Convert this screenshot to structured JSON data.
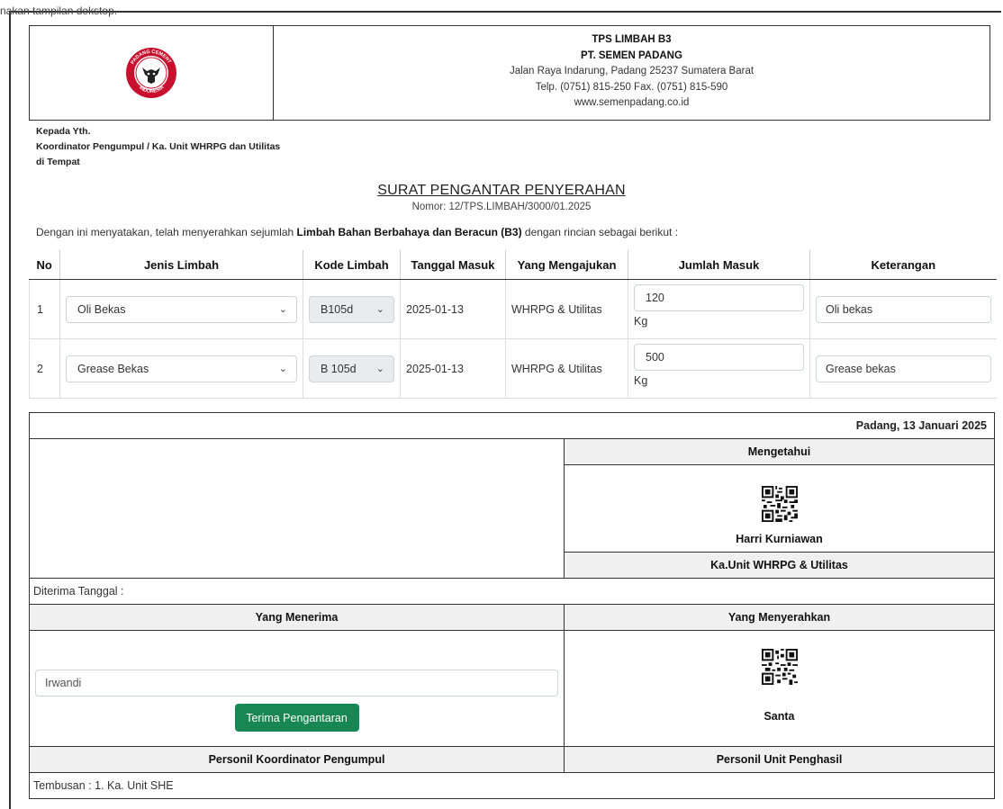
{
  "top_note": "nakan tampilan dekstop.",
  "header": {
    "logo_text": "PADANG CEMENT INDONESIA",
    "line1": "TPS LIMBAH B3",
    "line2": "PT. SEMEN PADANG",
    "line3": "Jalan Raya Indarung, Padang 25237 Sumatera Barat",
    "line4": "Telp. (0751) 815-250 Fax. (0751) 815-590",
    "line5": "www.semenpadang.co.id"
  },
  "address": {
    "line1": "Kepada Yth.",
    "line2": "Koordinator Pengumpul / Ka. Unit WHRPG dan Utilitas",
    "line3": "di Tempat"
  },
  "title": "SURAT PENGANTAR PENYERAHAN",
  "nomor": "Nomor: 12/TPS.LIMBAH/3000/01.2025",
  "intro": {
    "pre": "Dengan ini menyatakan, telah menyerahkan sejumlah ",
    "bold": "Limbah Bahan Berbahaya dan Beracun (B3)",
    "post": " dengan rincian sebagai berikut :"
  },
  "table": {
    "headers": [
      "No",
      "Jenis Limbah",
      "Kode Limbah",
      "Tanggal Masuk",
      "Yang Mengajukan",
      "Jumlah Masuk",
      "Keterangan"
    ],
    "rows": [
      {
        "no": "1",
        "jenis": "Oli Bekas",
        "kode": "B105d",
        "tanggal": "2025-01-13",
        "pengaju": "WHRPG & Utilitas",
        "jumlah": "120",
        "satuan": "Kg",
        "keterangan": "Oli bekas"
      },
      {
        "no": "2",
        "jenis": "Grease Bekas",
        "kode": "B 105d",
        "tanggal": "2025-01-13",
        "pengaju": "WHRPG & Utilitas",
        "jumlah": "500",
        "satuan": "Kg",
        "keterangan": "Grease bekas"
      }
    ]
  },
  "signature": {
    "date": "Padang, 13 Januari 2025",
    "mengetahui": "Mengetahui",
    "mengetahui_name": "Harri Kurniawan",
    "mengetahui_role": "Ka.Unit WHRPG & Utilitas",
    "diterima": "Diterima Tanggal :",
    "penerima_header": "Yang Menerima",
    "penyerah_header": "Yang Menyerahkan",
    "penerima_name": "Irwandi",
    "accept_button": "Terima Pengantaran",
    "penyerah_name": "Santa",
    "penerima_role": "Personil Koordinator Pengumpul",
    "penyerah_role": "Personil Unit Penghasil",
    "tembusan": "Tembusan : 1. Ka. Unit SHE"
  },
  "colors": {
    "button": "#198754",
    "logo_red": "#c8102e",
    "header_bg": "#f0f0f0"
  },
  "icons": {
    "select_chevron": "chevron-down-icon",
    "qr": "qr-code-icon",
    "logo": "semen-padang-logo"
  }
}
